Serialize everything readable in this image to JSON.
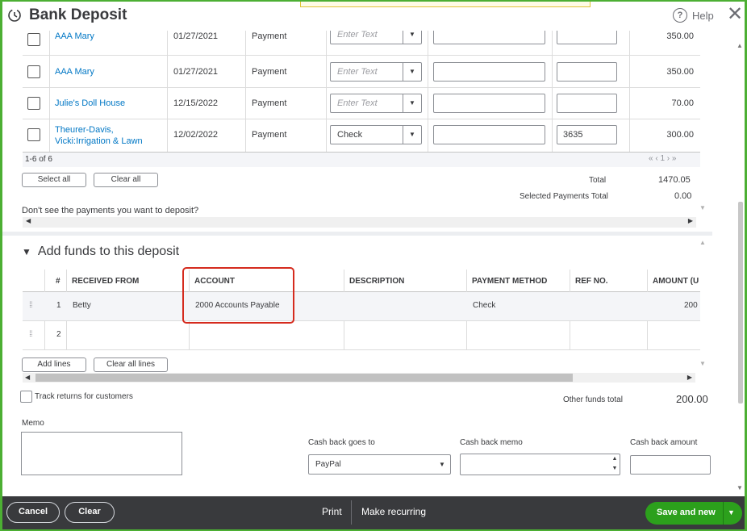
{
  "header": {
    "title": "Bank Deposit",
    "help_label": "Help"
  },
  "payments": {
    "rows": [
      {
        "name": "AAA Mary",
        "date": "01/27/2021",
        "type": "Payment",
        "method": "",
        "method_placeholder": "Enter Text",
        "ref": "",
        "amount": "350.00",
        "partial": true
      },
      {
        "name": "AAA Mary",
        "date": "01/27/2021",
        "type": "Payment",
        "method": "",
        "method_placeholder": "Enter Text",
        "ref": "",
        "amount": "350.00"
      },
      {
        "name": "Julie's Doll House",
        "date": "12/15/2022",
        "type": "Payment",
        "method": "",
        "method_placeholder": "Enter Text",
        "ref": "",
        "amount": "70.00"
      },
      {
        "name": "Theurer-Davis, Vicki:Irrigation & Lawn",
        "name_line1": "Theurer-Davis,",
        "name_line2": "Vicki:Irrigation & Lawn",
        "date": "12/02/2022",
        "type": "Payment",
        "method": "Check",
        "ref": "3635",
        "amount": "300.00"
      }
    ],
    "pagination": "1-6 of 6",
    "pager_icons": "« ‹ 1 › »",
    "select_all_label": "Select all",
    "clear_all_label": "Clear all",
    "total_label": "Total",
    "total_value": "1470.05",
    "selected_total_label": "Selected Payments Total",
    "selected_total_value": "0.00",
    "missing_link": "Don't see the payments you want to deposit?"
  },
  "funds": {
    "section_title": "Add funds to this deposit",
    "columns": [
      "#",
      "RECEIVED FROM",
      "ACCOUNT",
      "DESCRIPTION",
      "PAYMENT METHOD",
      "REF NO.",
      "AMOUNT (U"
    ],
    "rows": [
      {
        "num": "1",
        "received_from": "Betty",
        "account": "2000 Accounts Payable",
        "description": "",
        "method": "Check",
        "ref": "",
        "amount": "200"
      },
      {
        "num": "2",
        "received_from": "",
        "account": "",
        "description": "",
        "method": "",
        "ref": "",
        "amount": ""
      }
    ],
    "add_lines_label": "Add lines",
    "clear_all_lines_label": "Clear all lines",
    "track_returns_label": "Track returns for customers",
    "other_funds_total_label": "Other funds total",
    "other_funds_total_value": "200.00"
  },
  "bottom": {
    "memo_label": "Memo",
    "cash_back_goes_to_label": "Cash back goes to",
    "cash_back_goes_to_value": "PayPal",
    "cash_back_memo_label": "Cash back memo",
    "cash_back_amount_label": "Cash back amount"
  },
  "footer": {
    "cancel_label": "Cancel",
    "clear_label": "Clear",
    "print_label": "Print",
    "recurring_label": "Make recurring",
    "save_label": "Save and new"
  },
  "colors": {
    "accent_green": "#2ca01c",
    "link_blue": "#0077c5",
    "footer_bg": "#393a3d",
    "highlight_red": "#d52b1e"
  }
}
